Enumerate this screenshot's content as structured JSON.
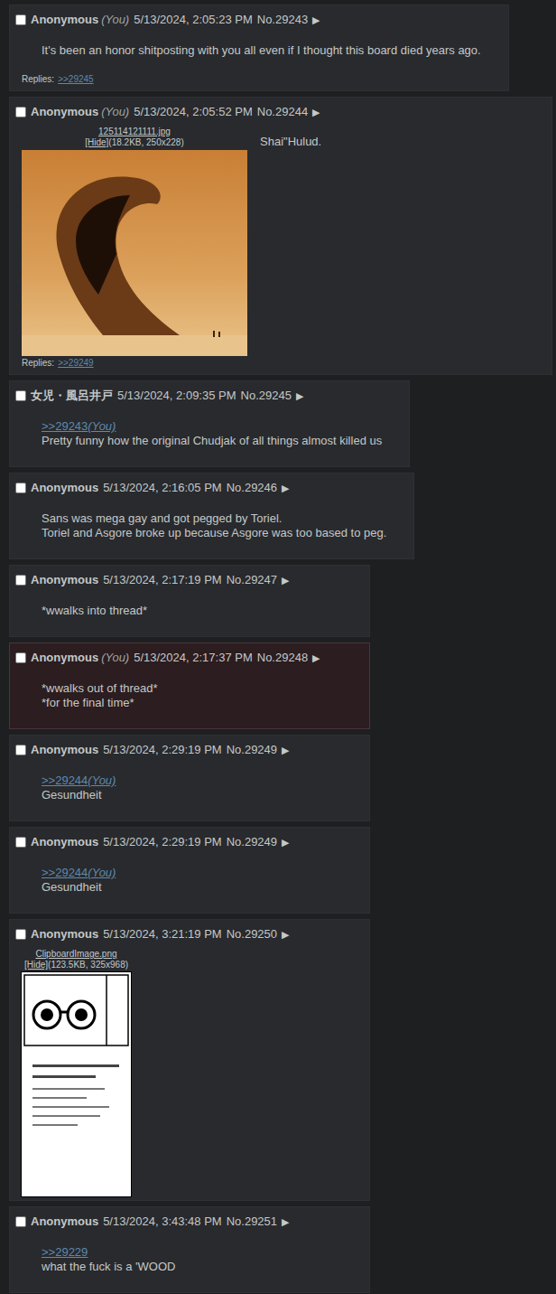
{
  "you_label": "(You)",
  "menu_arrow": "▶",
  "posts": [
    {
      "name": "Anonymous",
      "you": true,
      "date": "5/13/2024, 2:05:23 PM",
      "number": "No.29243",
      "checked": false,
      "highlighted": false,
      "file": null,
      "quotes": [],
      "lines": [
        "It's been an honor shitposting with you all even if I thought this board died years ago."
      ],
      "replies": {
        "label": "Replies:",
        "links": [
          ">>29245"
        ]
      }
    },
    {
      "name": "Anonymous",
      "you": true,
      "date": "5/13/2024, 2:05:52 PM",
      "number": "No.29244",
      "checked": false,
      "highlighted": false,
      "file": {
        "name": "125114121111.jpg",
        "hide": "[Hide]",
        "info": "(18.2KB, 250x228)",
        "kind": "dune"
      },
      "quotes": [],
      "lines": [
        "Shai\"Hulud."
      ],
      "replies": {
        "label": "Replies:",
        "links": [
          ">>29249"
        ]
      }
    },
    {
      "name": "女児・風呂井戸",
      "you": false,
      "date": "5/13/2024, 2:09:35 PM",
      "number": "No.29245",
      "checked": false,
      "highlighted": false,
      "file": null,
      "quotes": [
        {
          "ref": ">>29243",
          "you": true
        }
      ],
      "lines": [
        "Pretty funny how the original Chudjak of all things almost killed us"
      ],
      "replies": null
    },
    {
      "name": "Anonymous",
      "you": false,
      "date": "5/13/2024, 2:16:05 PM",
      "number": "No.29246",
      "checked": false,
      "highlighted": false,
      "file": null,
      "quotes": [],
      "lines": [
        "Sans was mega gay and got pegged by Toriel.",
        "Toriel and Asgore broke up because Asgore was too based to peg."
      ],
      "replies": null
    },
    {
      "name": "Anonymous",
      "you": false,
      "date": "5/13/2024, 2:17:19 PM",
      "number": "No.29247",
      "checked": false,
      "highlighted": false,
      "file": null,
      "quotes": [],
      "lines": [
        "*wwalks into thread*"
      ],
      "replies": null
    },
    {
      "name": "Anonymous",
      "you": true,
      "date": "5/13/2024, 2:17:37 PM",
      "number": "No.29248",
      "checked": false,
      "highlighted": true,
      "file": null,
      "quotes": [],
      "lines": [
        "*wwalks out of thread*",
        "*for the final time*"
      ],
      "replies": null
    },
    {
      "name": "Anonymous",
      "you": false,
      "date": "5/13/2024, 2:29:19 PM",
      "number": "No.29249",
      "checked": false,
      "highlighted": false,
      "file": null,
      "quotes": [
        {
          "ref": ">>29244",
          "you": true
        }
      ],
      "lines": [
        "Gesundheit"
      ],
      "replies": null
    },
    {
      "name": "Anonymous",
      "you": false,
      "date": "5/13/2024, 2:29:19 PM",
      "number": "No.29249",
      "checked": false,
      "highlighted": false,
      "file": null,
      "quotes": [
        {
          "ref": ">>29244",
          "you": true
        }
      ],
      "lines": [
        "Gesundheit"
      ],
      "replies": null
    },
    {
      "name": "Anonymous",
      "you": false,
      "date": "5/13/2024, 3:21:19 PM",
      "number": "No.29250",
      "checked": false,
      "highlighted": false,
      "file": {
        "name": "ClipboardImage.png",
        "hide": "[Hide]",
        "info": "(123.5KB, 325x968)",
        "kind": "manga"
      },
      "quotes": [],
      "lines": [],
      "replies": null
    },
    {
      "name": "Anonymous",
      "you": false,
      "date": "5/13/2024, 3:43:48 PM",
      "number": "No.29251",
      "checked": false,
      "highlighted": false,
      "file": null,
      "quotes": [
        {
          "ref": ">>29229",
          "you": false
        }
      ],
      "lines": [
        "what the fuck is a 'WOOD"
      ],
      "replies": null
    }
  ]
}
